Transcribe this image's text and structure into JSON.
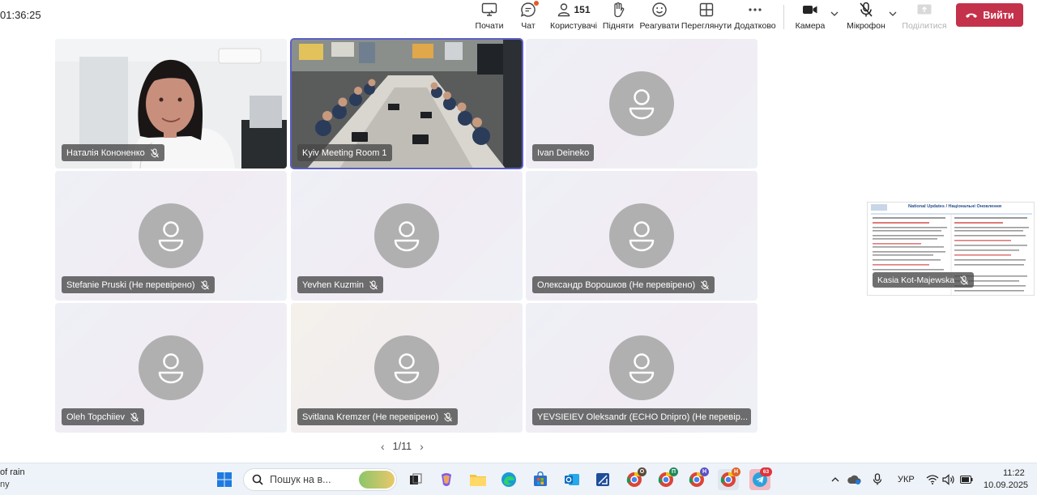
{
  "toolbar": {
    "timer": "01:36:25",
    "start": "Почати",
    "chat": "Чат",
    "people_count": "151",
    "people": "Користувачі",
    "raise": "Підняти",
    "react": "Реагувати",
    "view": "Переглянути",
    "more": "Додатково",
    "camera": "Камера",
    "mic": "Мікрофон",
    "share": "Поділитися",
    "leave": "Вийти"
  },
  "participants": [
    {
      "name": "Наталія Кононенко",
      "muted": true
    },
    {
      "name": "Kyiv Meeting Room 1",
      "muted": false
    },
    {
      "name": "Ivan Deineko",
      "muted": false
    },
    {
      "name": "Stefanie Pruski (Не перевірено)",
      "muted": true
    },
    {
      "name": "Yevhen Kuzmin",
      "muted": true
    },
    {
      "name": "Олександр Ворошков (Не перевірено)",
      "muted": true
    },
    {
      "name": "Oleh Topchiiev",
      "muted": true
    },
    {
      "name": "Svitlana Kremzer (Не перевірено)",
      "muted": true
    },
    {
      "name": "YEVSIEIEV Oleksandr (ECHO Dnipro) (Не перевір...",
      "muted": true
    }
  ],
  "pager": {
    "text": "1/11"
  },
  "shared_screen": {
    "presenter": "Kasia Kot-Majewska",
    "slide_title": "National Updates / Національні Оновлення"
  },
  "taskbar": {
    "weather_line1": "of rain",
    "weather_line2": "ny",
    "search_placeholder": "Пошук на в...",
    "language": "УКР",
    "time": "11:22",
    "date": "10.09.2025",
    "telegram_badge": "63"
  },
  "colors": {
    "accent": "#5b5fc7",
    "leave": "#c4314b",
    "avatar": "#b1b0b0"
  }
}
